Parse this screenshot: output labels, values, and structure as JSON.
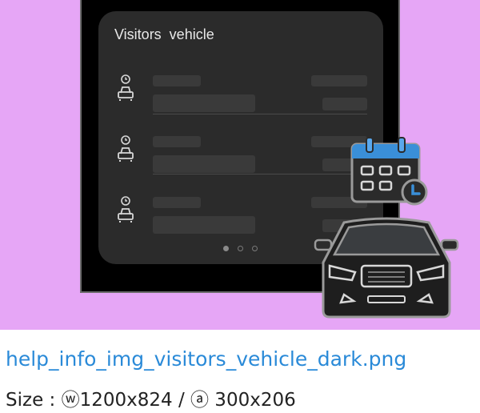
{
  "preview": {
    "background_color": "#e6a6f6",
    "widget": {
      "title": "Visitors  vehicle",
      "rows": [
        {
          "icon": "car-clock-icon"
        },
        {
          "icon": "car-clock-icon"
        },
        {
          "icon": "car-clock-icon"
        }
      ],
      "pagination": {
        "total": 3,
        "active_index": 0
      }
    },
    "overlay_icons": [
      "calendar-clock-icon",
      "car-front-icon"
    ]
  },
  "caption": {
    "filename": "help_info_img_visitors_vehicle_dark.png",
    "size_text": "Size : ⓦ1200x824 / ⓐ 300x206"
  },
  "colors": {
    "caption_link": "#2a8ad8",
    "widget_bg": "#2b2b2b",
    "phone_bg": "#000000",
    "calendar_accent": "#3a8fd8"
  }
}
